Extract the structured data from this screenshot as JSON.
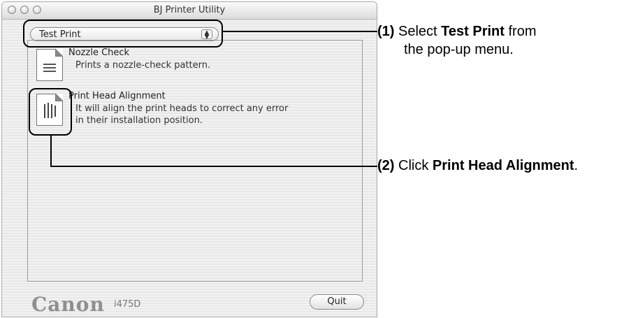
{
  "window": {
    "title": "BJ Printer Utility"
  },
  "popup": {
    "selected": "Test Print"
  },
  "items": [
    {
      "title": "Nozzle Check",
      "desc_lines": [
        "Prints a nozzle-check pattern."
      ]
    },
    {
      "title": "Print Head Alignment",
      "desc_lines": [
        "It will align the print heads to correct any error",
        "in their installation position."
      ]
    }
  ],
  "footer": {
    "brand": "Canon",
    "model": "i475D",
    "quit_label": "Quit"
  },
  "annotations": {
    "a1_num": "(1)",
    "a1_pre": "Select",
    "a1_bold": "Test Print",
    "a1_post": "from",
    "a1_line2": "the pop-up menu.",
    "a2_num": "(2)",
    "a2_pre": "Click",
    "a2_bold": "Print Head Alignment",
    "a2_post": "."
  }
}
